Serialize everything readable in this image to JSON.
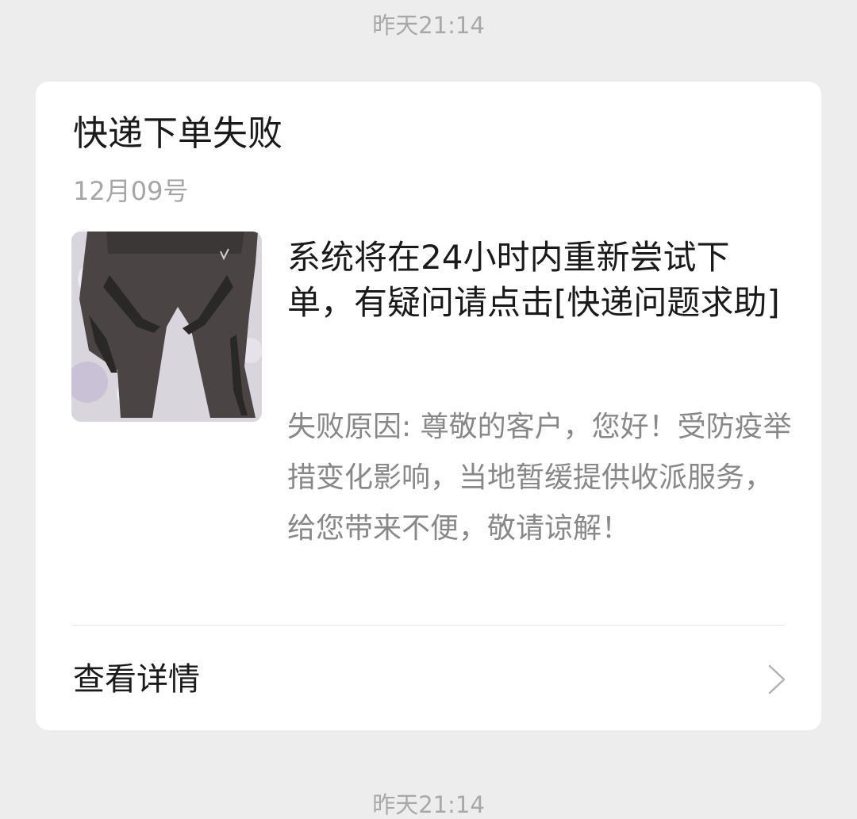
{
  "timestamps": {
    "top": "昨天21:14",
    "bottom": "昨天21:14"
  },
  "card": {
    "title": "快递下单失败",
    "date": "12月09号",
    "thumbnail_icon": "product-photo-leggings",
    "headline": "系统将在24小时内重新尝试下单，有疑问请点击[快递问题求助]",
    "reason": "失败原因: 尊敬的客户，您好！受防疫举措变化影响，当地暂缓提供收派服务，给您带来不便，敬请谅解！",
    "detail_label": "查看详情",
    "detail_icon": "chevron-right-icon"
  }
}
